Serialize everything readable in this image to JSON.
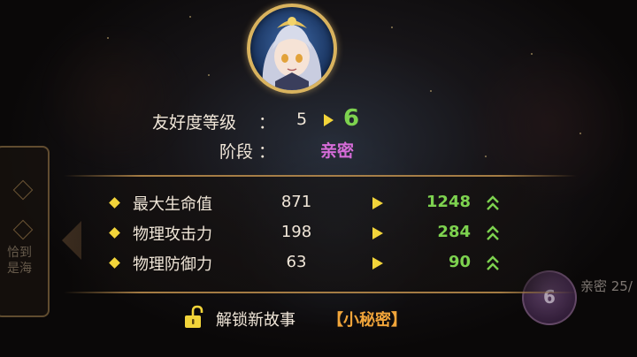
{
  "side_tab": {
    "label": "恰到是海"
  },
  "avatar": {
    "icon": "character-portrait"
  },
  "friendship": {
    "level_label": "友好度等级",
    "colon": "：",
    "old_level": "5",
    "new_level": "6",
    "stage_label": "阶段",
    "stage_value": "亲密"
  },
  "stats": [
    {
      "name": "最大生命值",
      "old": "871",
      "new": "1248"
    },
    {
      "name": "物理攻击力",
      "old": "198",
      "new": "284"
    },
    {
      "name": "物理防御力",
      "old": "63",
      "new": "90"
    }
  ],
  "unlock": {
    "label": "解锁新故事",
    "tag": "【小秘密】"
  },
  "right_hint": {
    "badge_number": "6",
    "text": "亲密 25/"
  },
  "colors": {
    "gold": "#f2d43a",
    "green": "#7dd24f",
    "purple": "#d66cd8",
    "orange": "#f1a53a"
  }
}
